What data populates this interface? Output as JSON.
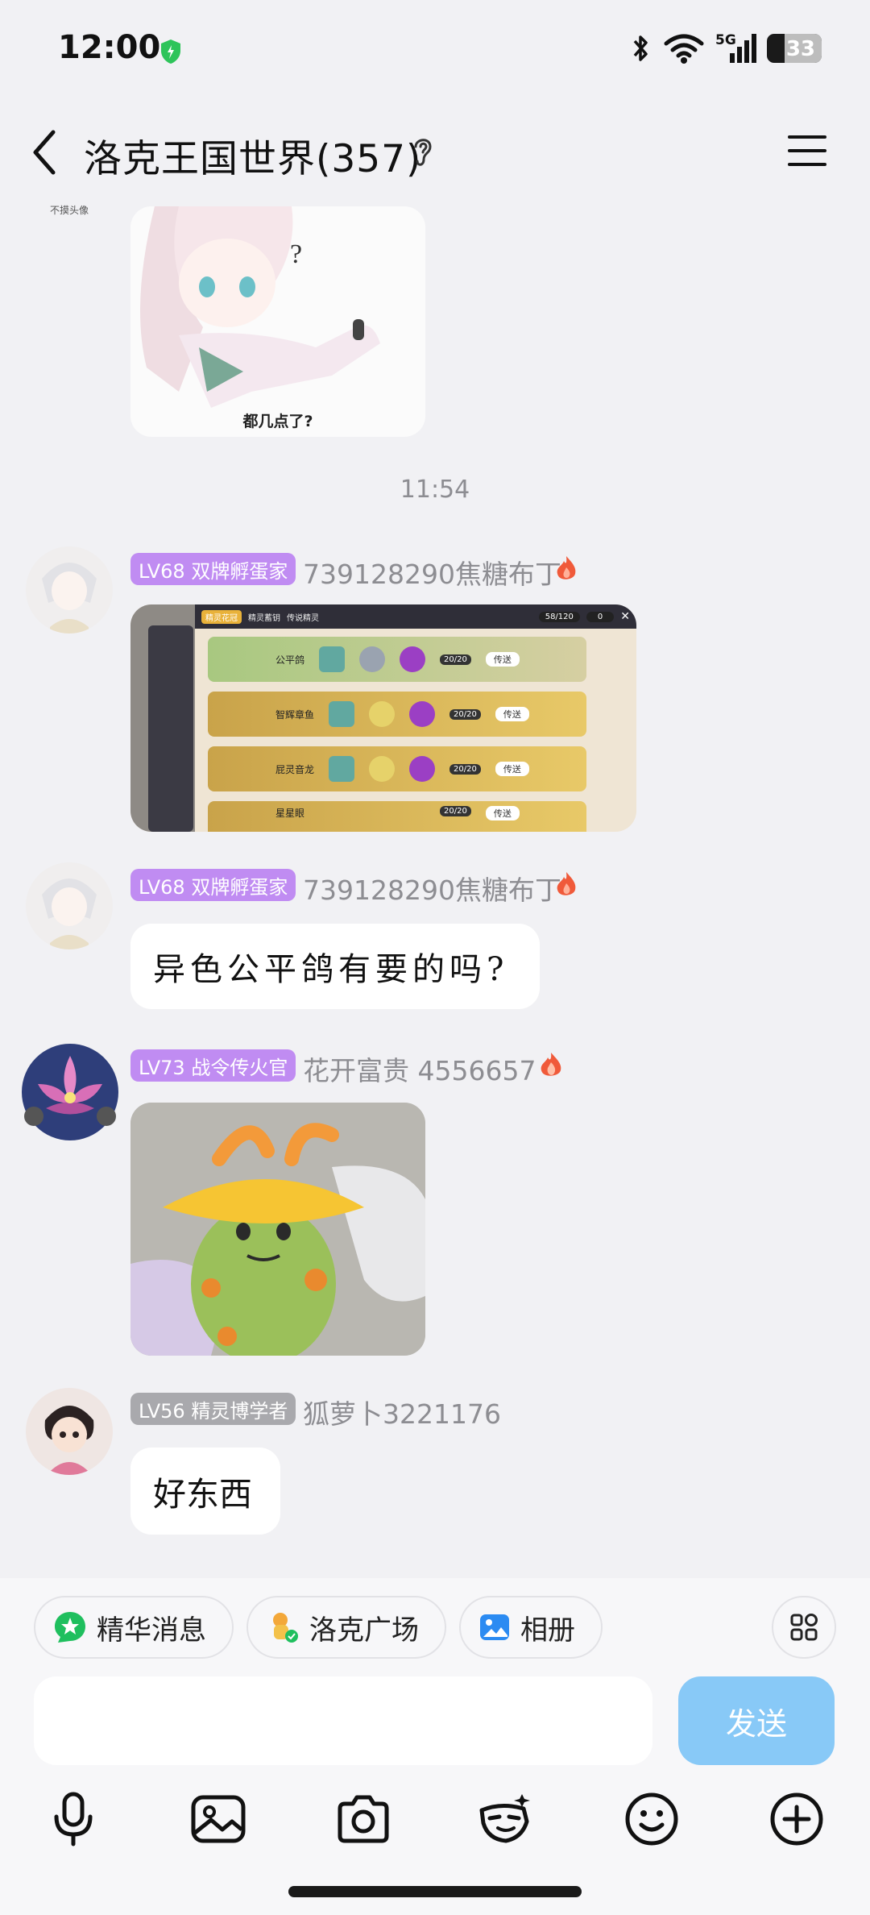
{
  "status_bar": {
    "time": "12:00",
    "network": "5G",
    "battery": "33",
    "battery_level": 0.33
  },
  "header": {
    "title": "洛克王国世界(357)"
  },
  "messages": [
    {
      "avatar_caption": "不摸头像",
      "image_caption": "都几点了?"
    },
    {
      "time_separator": "11:54"
    },
    {
      "badge": "LV68 双牌孵蛋家",
      "sender": "739128290焦糖布丁",
      "image_panel": {
        "tabs": [
          "精灵花冠",
          "精灵蓄钥",
          "传说精灵"
        ],
        "counter_1": "58/120",
        "counter_2": "0",
        "rows": [
          {
            "name": "公平鸽",
            "count": "20/20",
            "button": "传送"
          },
          {
            "name": "智辉章鱼",
            "count": "20/20",
            "button": "传送"
          },
          {
            "name": "屁灵音龙",
            "count": "20/20",
            "button": "传送"
          },
          {
            "name": "星星眼",
            "count": "20/20",
            "button": "传送"
          }
        ]
      }
    },
    {
      "badge": "LV68 双牌孵蛋家",
      "sender": "739128290焦糖布丁",
      "text": "异色公平鸽有要的吗?"
    },
    {
      "badge": "LV73 战令传火官",
      "sender": "花开富贵 4556657"
    },
    {
      "badge": "LV56 精灵博学者",
      "sender": "狐萝卜3221176",
      "text": "好东西"
    }
  ],
  "quick_bar": {
    "chips": [
      "精华消息",
      "洛克广场",
      "相册"
    ]
  },
  "composer": {
    "send_label": "发送"
  },
  "toolbar": {
    "icons": [
      "microphone-icon",
      "image-icon",
      "camera-icon",
      "sticker-icon",
      "emoji-icon",
      "plus-icon"
    ]
  },
  "colors": {
    "badge_purple": "#c08cf2",
    "badge_gray": "#a9a9ad",
    "send_button": "#88c9f7",
    "background": "#f1f1f4"
  }
}
